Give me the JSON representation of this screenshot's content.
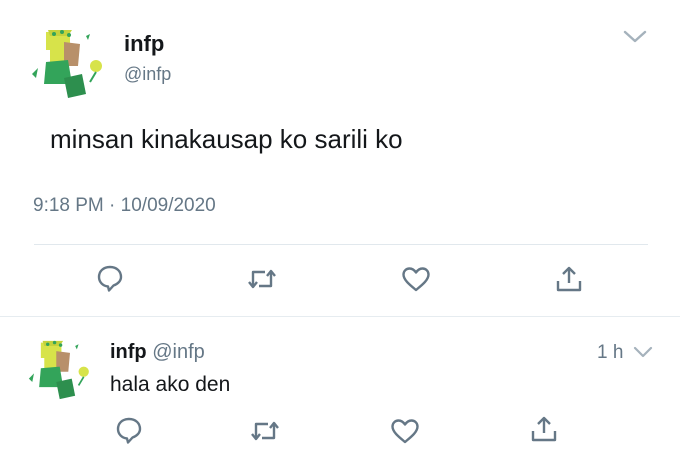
{
  "tweet": {
    "display_name": "infp",
    "handle": "@infp",
    "text": "minsan kinakausap ko sarili ko",
    "time": "9:18 PM",
    "separator": "·",
    "date": "10/09/2020",
    "menu_icon": "chevron-down-icon",
    "actions": [
      "reply-icon",
      "retweet-icon",
      "like-icon",
      "share-icon"
    ]
  },
  "reply": {
    "display_name": "infp",
    "handle": "@infp",
    "age": "1 h",
    "text": "hala ako den",
    "menu_icon": "chevron-down-icon",
    "actions": [
      "reply-icon",
      "retweet-icon",
      "like-icon",
      "share-icon"
    ]
  },
  "colors": {
    "icon_gray": "#657786",
    "avatar_yellow": "#d7e34a",
    "avatar_green": "#33a45a",
    "divider": "#e1e8ed"
  }
}
